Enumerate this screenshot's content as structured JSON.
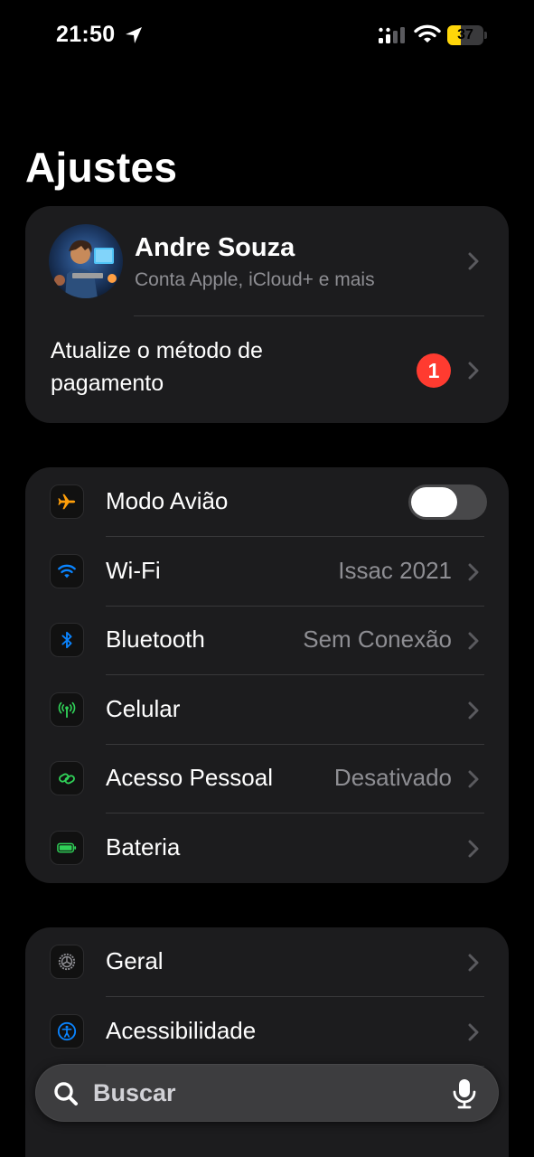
{
  "status": {
    "time": "21:50",
    "battery_level": "37",
    "battery_fraction": 0.37,
    "battery_color": "#ffd60a",
    "icons": [
      "location-arrow",
      "cellular-signal",
      "wifi",
      "battery"
    ]
  },
  "title": "Ajustes",
  "profile": {
    "name": "Andre Souza",
    "subtitle": "Conta Apple, iCloud+ e mais",
    "payment_label": "Atualize o método de pagamento",
    "badge_count": "1"
  },
  "network": {
    "items": [
      {
        "label": "Modo Avião",
        "icon": "airplane-icon",
        "toggle_on": false
      },
      {
        "label": "Wi-Fi",
        "value": "Issac 2021",
        "icon": "wifi-icon"
      },
      {
        "label": "Bluetooth",
        "value": "Sem Conexão",
        "icon": "bluetooth-icon"
      },
      {
        "label": "Celular",
        "icon": "antenna-icon"
      },
      {
        "label": "Acesso Pessoal",
        "value": "Desativado",
        "icon": "link-icon"
      },
      {
        "label": "Bateria",
        "icon": "battery-icon"
      }
    ]
  },
  "general": {
    "items": [
      {
        "label": "Geral",
        "icon": "gear-icon"
      },
      {
        "label": "Acessibilidade",
        "icon": "accessibility-icon"
      }
    ]
  },
  "search": {
    "placeholder": "Buscar"
  },
  "colors": {
    "airplane": "#ff9f0a",
    "wifi": "#0a84ff",
    "bluetooth": "#0a84ff",
    "cellular": "#30d158",
    "hotspot": "#30d158",
    "battery": "#30d158",
    "badge": "#ff3b30"
  }
}
